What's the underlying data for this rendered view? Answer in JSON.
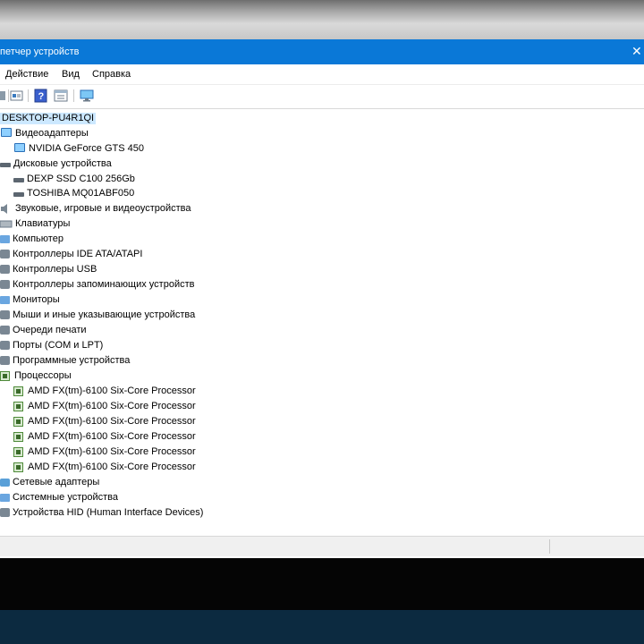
{
  "window": {
    "title": "петчер устройств",
    "close_glyph": "✕"
  },
  "menu": {
    "items": [
      "Действие",
      "Вид",
      "Справка"
    ]
  },
  "toolbar": {
    "buttons": [
      "back-icon",
      "properties-icon",
      "help-icon",
      "view-icon",
      "monitor-scan-icon"
    ]
  },
  "tree": {
    "root": "DESKTOP-PU4R1QI",
    "rows": [
      {
        "label": "Видеоадаптеры",
        "icon": "display-adapter-icon",
        "level": 1
      },
      {
        "label": "NVIDIA GeForce GTS 450",
        "icon": "display-adapter-icon",
        "level": 2
      },
      {
        "label": "Дисковые устройства",
        "icon": "disk-icon",
        "level": 1
      },
      {
        "label": "DEXP SSD C100 256Gb",
        "icon": "disk-icon",
        "level": 2
      },
      {
        "label": "TOSHIBA MQ01ABF050",
        "icon": "disk-icon",
        "level": 2
      },
      {
        "label": "Звуковые, игровые и видеоустройства",
        "icon": "speaker-icon",
        "level": 1
      },
      {
        "label": "Клавиатуры",
        "icon": "keyboard-icon",
        "level": 1
      },
      {
        "label": "Компьютер",
        "icon": "computer-icon",
        "level": 1
      },
      {
        "label": "Контроллеры IDE ATA/ATAPI",
        "icon": "ide-controller-icon",
        "level": 1
      },
      {
        "label": "Контроллеры USB",
        "icon": "usb-icon",
        "level": 1
      },
      {
        "label": "Контроллеры запоминающих устройств",
        "icon": "storage-controller-icon",
        "level": 1
      },
      {
        "label": "Мониторы",
        "icon": "monitor-icon",
        "level": 1
      },
      {
        "label": "Мыши и иные указывающие устройства",
        "icon": "mouse-icon",
        "level": 1
      },
      {
        "label": "Очереди печати",
        "icon": "printer-icon",
        "level": 1
      },
      {
        "label": "Порты (COM и LPT)",
        "icon": "port-icon",
        "level": 1
      },
      {
        "label": "Программные устройства",
        "icon": "software-device-icon",
        "level": 1
      },
      {
        "label": "Процессоры",
        "icon": "cpu-icon",
        "level": 1
      },
      {
        "label": "AMD FX(tm)-6100 Six-Core Processor",
        "icon": "cpu-icon",
        "level": 2
      },
      {
        "label": "AMD FX(tm)-6100 Six-Core Processor",
        "icon": "cpu-icon",
        "level": 2
      },
      {
        "label": "AMD FX(tm)-6100 Six-Core Processor",
        "icon": "cpu-icon",
        "level": 2
      },
      {
        "label": "AMD FX(tm)-6100 Six-Core Processor",
        "icon": "cpu-icon",
        "level": 2
      },
      {
        "label": "AMD FX(tm)-6100 Six-Core Processor",
        "icon": "cpu-icon",
        "level": 2
      },
      {
        "label": "AMD FX(tm)-6100 Six-Core Processor",
        "icon": "cpu-icon",
        "level": 2
      },
      {
        "label": "Сетевые адаптеры",
        "icon": "network-adapter-icon",
        "level": 1
      },
      {
        "label": "Системные устройства",
        "icon": "system-device-icon",
        "level": 1
      },
      {
        "label": "Устройства HID (Human Interface Devices)",
        "icon": "hid-icon",
        "level": 1
      }
    ]
  },
  "colors": {
    "titlebar": "#0a78d7",
    "selection": "#cce8ff",
    "taskbar": "#0c2a40"
  }
}
